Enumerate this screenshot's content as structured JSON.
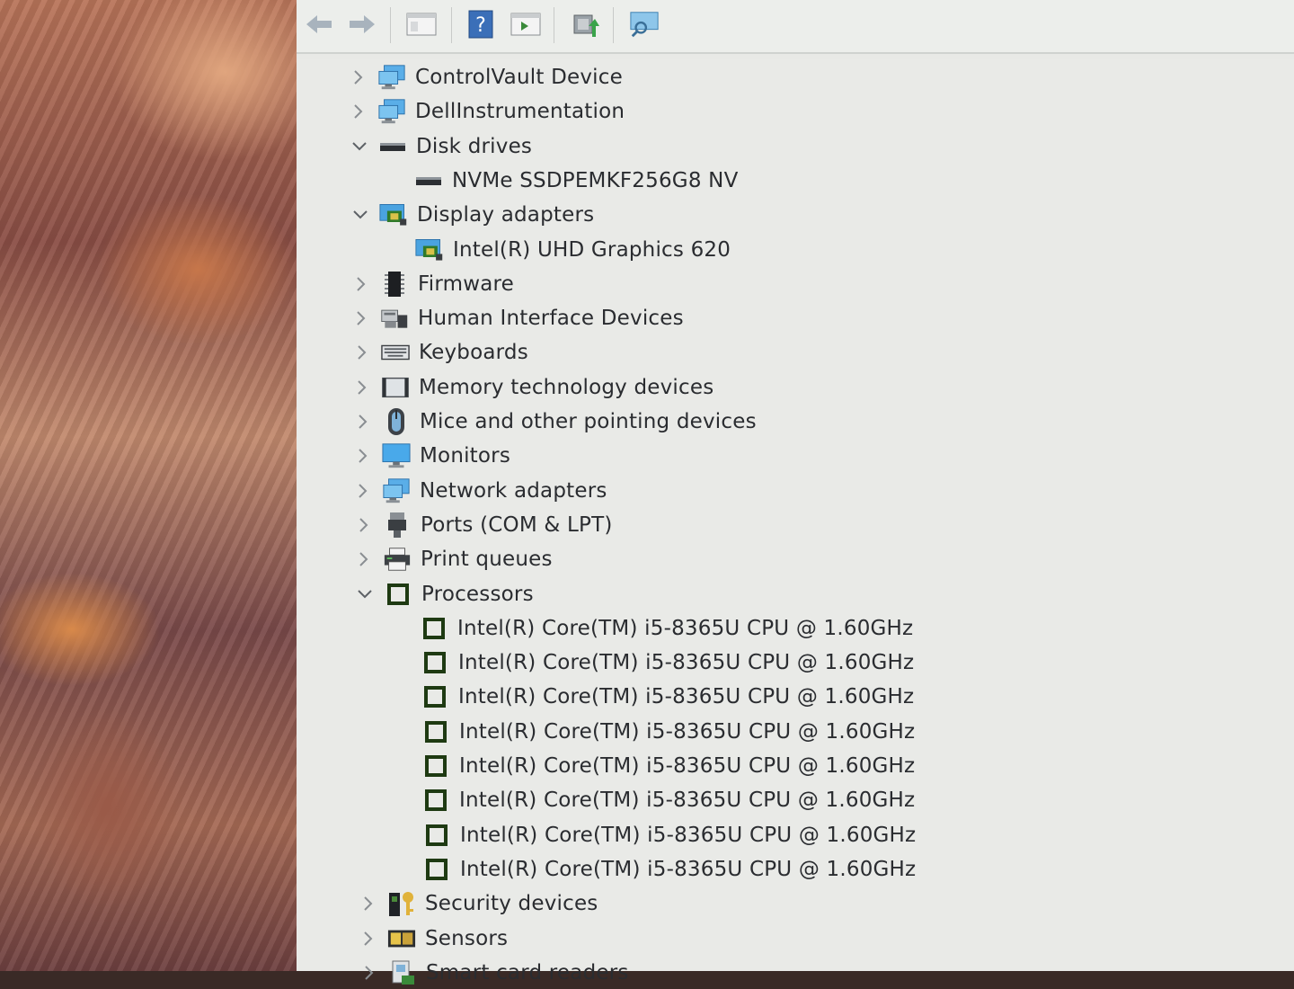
{
  "toolbar": {
    "buttons": [
      "back-icon",
      "forward-icon",
      "show-hide-tree-icon",
      "help-icon",
      "properties-icon",
      "update-driver-icon",
      "scan-hardware-icon"
    ]
  },
  "tree": {
    "items": [
      {
        "label": "ControlVault Device",
        "expanded": false,
        "level": 0,
        "icon": "monitor-network-icon"
      },
      {
        "label": "DellInstrumentation",
        "expanded": false,
        "level": 0,
        "icon": "monitor-network-icon"
      },
      {
        "label": "Disk drives",
        "expanded": true,
        "level": 0,
        "icon": "disk-drive-icon"
      },
      {
        "label": "NVMe SSDPEMKF256G8 NV",
        "level": 1,
        "icon": "disk-drive-icon"
      },
      {
        "label": "Display adapters",
        "expanded": true,
        "level": 0,
        "icon": "display-adapter-icon"
      },
      {
        "label": "Intel(R) UHD Graphics 620",
        "level": 1,
        "icon": "display-adapter-icon"
      },
      {
        "label": "Firmware",
        "expanded": false,
        "level": 0,
        "icon": "firmware-chip-icon"
      },
      {
        "label": "Human Interface Devices",
        "expanded": false,
        "level": 0,
        "icon": "hid-icon"
      },
      {
        "label": "Keyboards",
        "expanded": false,
        "level": 0,
        "icon": "keyboard-icon"
      },
      {
        "label": "Memory technology devices",
        "expanded": false,
        "level": 0,
        "icon": "memory-card-icon"
      },
      {
        "label": "Mice and other pointing devices",
        "expanded": false,
        "level": 0,
        "icon": "mouse-icon"
      },
      {
        "label": "Monitors",
        "expanded": false,
        "level": 0,
        "icon": "monitor-icon"
      },
      {
        "label": "Network adapters",
        "expanded": false,
        "level": 0,
        "icon": "monitor-network-icon"
      },
      {
        "label": "Ports (COM & LPT)",
        "expanded": false,
        "level": 0,
        "icon": "port-icon"
      },
      {
        "label": "Print queues",
        "expanded": false,
        "level": 0,
        "icon": "printer-icon"
      },
      {
        "label": "Processors",
        "expanded": true,
        "level": 0,
        "icon": "processor-icon"
      },
      {
        "label": "Intel(R) Core(TM) i5-8365U CPU @ 1.60GHz",
        "level": 1,
        "icon": "processor-icon"
      },
      {
        "label": "Intel(R) Core(TM) i5-8365U CPU @ 1.60GHz",
        "level": 1,
        "icon": "processor-icon"
      },
      {
        "label": "Intel(R) Core(TM) i5-8365U CPU @ 1.60GHz",
        "level": 1,
        "icon": "processor-icon"
      },
      {
        "label": "Intel(R) Core(TM) i5-8365U CPU @ 1.60GHz",
        "level": 1,
        "icon": "processor-icon"
      },
      {
        "label": "Intel(R) Core(TM) i5-8365U CPU @ 1.60GHz",
        "level": 1,
        "icon": "processor-icon"
      },
      {
        "label": "Intel(R) Core(TM) i5-8365U CPU @ 1.60GHz",
        "level": 1,
        "icon": "processor-icon"
      },
      {
        "label": "Intel(R) Core(TM) i5-8365U CPU @ 1.60GHz",
        "level": 1,
        "icon": "processor-icon"
      },
      {
        "label": "Intel(R) Core(TM) i5-8365U CPU @ 1.60GHz",
        "level": 1,
        "icon": "processor-icon"
      },
      {
        "label": "Security devices",
        "expanded": false,
        "level": 0,
        "icon": "security-key-icon"
      },
      {
        "label": "Sensors",
        "expanded": false,
        "level": 0,
        "icon": "sensor-icon"
      },
      {
        "label": "Smart card readers",
        "expanded": false,
        "level": 0,
        "icon": "smart-card-icon"
      }
    ]
  },
  "colors": {
    "accent": "#2a7fd0",
    "processor": "#2e5a1e",
    "text": "#2a2c30"
  }
}
